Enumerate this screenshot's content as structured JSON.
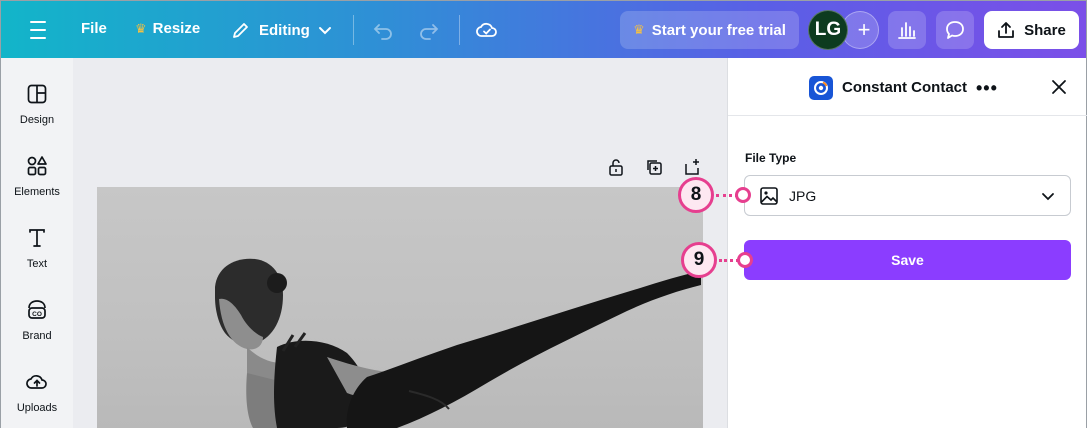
{
  "topbar": {
    "file_label": "File",
    "resize_label": "Resize",
    "editing_label": "Editing",
    "trial_label": "Start your free trial",
    "avatar_initials": "LG",
    "share_label": "Share"
  },
  "rail": {
    "items": [
      {
        "label": "Design",
        "icon": "design-icon"
      },
      {
        "label": "Elements",
        "icon": "elements-icon"
      },
      {
        "label": "Text",
        "icon": "text-icon"
      },
      {
        "label": "Brand",
        "icon": "brand-icon"
      },
      {
        "label": "Uploads",
        "icon": "uploads-icon"
      }
    ]
  },
  "panel": {
    "app_title": "Constant Contact",
    "file_type_label": "File Type",
    "file_type_value": "JPG",
    "save_label": "Save"
  },
  "callouts": {
    "step_8": "8",
    "step_9": "9"
  },
  "colors": {
    "accent_purple": "#8b3dff",
    "callout_pink": "#e63f8f",
    "avatar_green": "#0d3b1f"
  }
}
